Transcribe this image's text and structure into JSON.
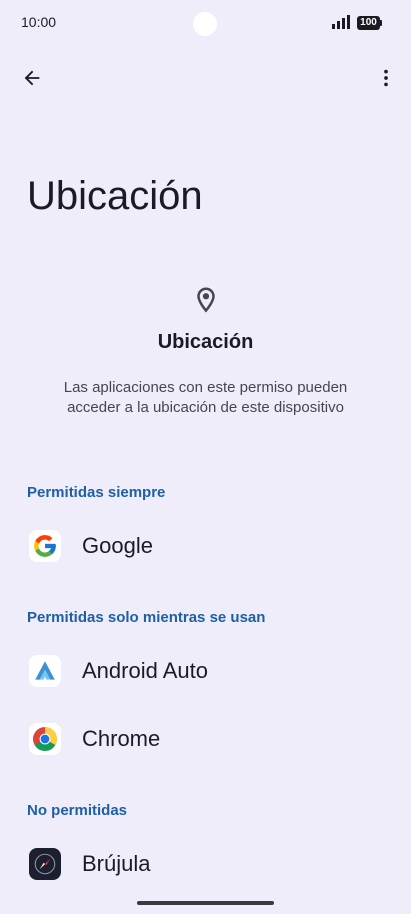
{
  "status_bar": {
    "time": "10:00",
    "battery": "100",
    "icons": [
      "signal-icon",
      "battery-icon"
    ]
  },
  "toolbar": {
    "back_icon": "arrow-back-icon",
    "more_icon": "more-vert-icon"
  },
  "page_title": "Ubicación",
  "header": {
    "icon": "location-pin-icon",
    "title": "Ubicación",
    "description": "Las aplicaciones con este permiso pueden acceder a la ubicación de este dispositivo"
  },
  "sections": [
    {
      "title": "Permitidas siempre",
      "apps": [
        {
          "label": "Google",
          "icon": "google-icon"
        }
      ]
    },
    {
      "title": "Permitidas solo mientras se usan",
      "apps": [
        {
          "label": "Android Auto",
          "icon": "android-auto-icon"
        },
        {
          "label": "Chrome",
          "icon": "chrome-icon"
        }
      ]
    },
    {
      "title": "No permitidas",
      "apps": [
        {
          "label": "Brújula",
          "icon": "compass-icon"
        }
      ]
    }
  ],
  "colors": {
    "background": "#eeedf9",
    "section_accent": "#1f5fa6",
    "text_primary": "#1d1b22"
  }
}
